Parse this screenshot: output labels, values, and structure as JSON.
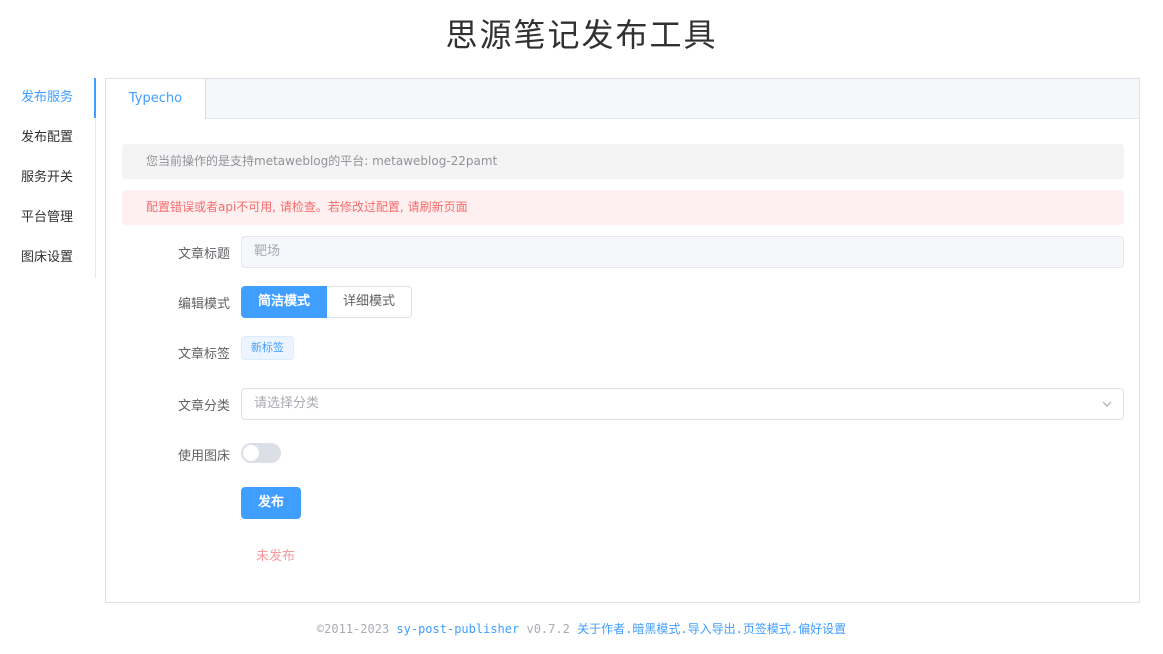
{
  "app_title": "思源笔记发布工具",
  "sidebar": {
    "items": [
      {
        "label": "发布服务",
        "active": true
      },
      {
        "label": "发布配置"
      },
      {
        "label": "服务开关"
      },
      {
        "label": "平台管理"
      },
      {
        "label": "图床设置"
      }
    ]
  },
  "tabs": [
    {
      "label": "Typecho",
      "active": true
    }
  ],
  "alerts": {
    "info": "您当前操作的是支持metaweblog的平台: metaweblog-22pamt",
    "error": "配置错误或者api不可用, 请检查。若修改过配置, 请刷新页面"
  },
  "form": {
    "title_label": "文章标题",
    "title_value": "靶场",
    "mode_label": "编辑模式",
    "mode_simple": "简洁模式",
    "mode_detail": "详细模式",
    "tags_label": "文章标签",
    "new_tag": "新标签",
    "category_label": "文章分类",
    "category_placeholder": "请选择分类",
    "picbed_label": "使用图床",
    "picbed_enabled": false,
    "publish_button": "发布",
    "status": "未发布"
  },
  "footer": {
    "copyright": "©2011-2023",
    "app_name": "sy-post-publisher",
    "version": "v0.7.2",
    "links": [
      "关于作者",
      "暗黑模式",
      "导入导出",
      "页签模式",
      "偏好设置"
    ],
    "separator": "."
  },
  "colors": {
    "accent": "#409eff",
    "error_text": "#f56c6c",
    "error_bg": "#fef0f0",
    "info_bg": "#f4f4f5"
  }
}
